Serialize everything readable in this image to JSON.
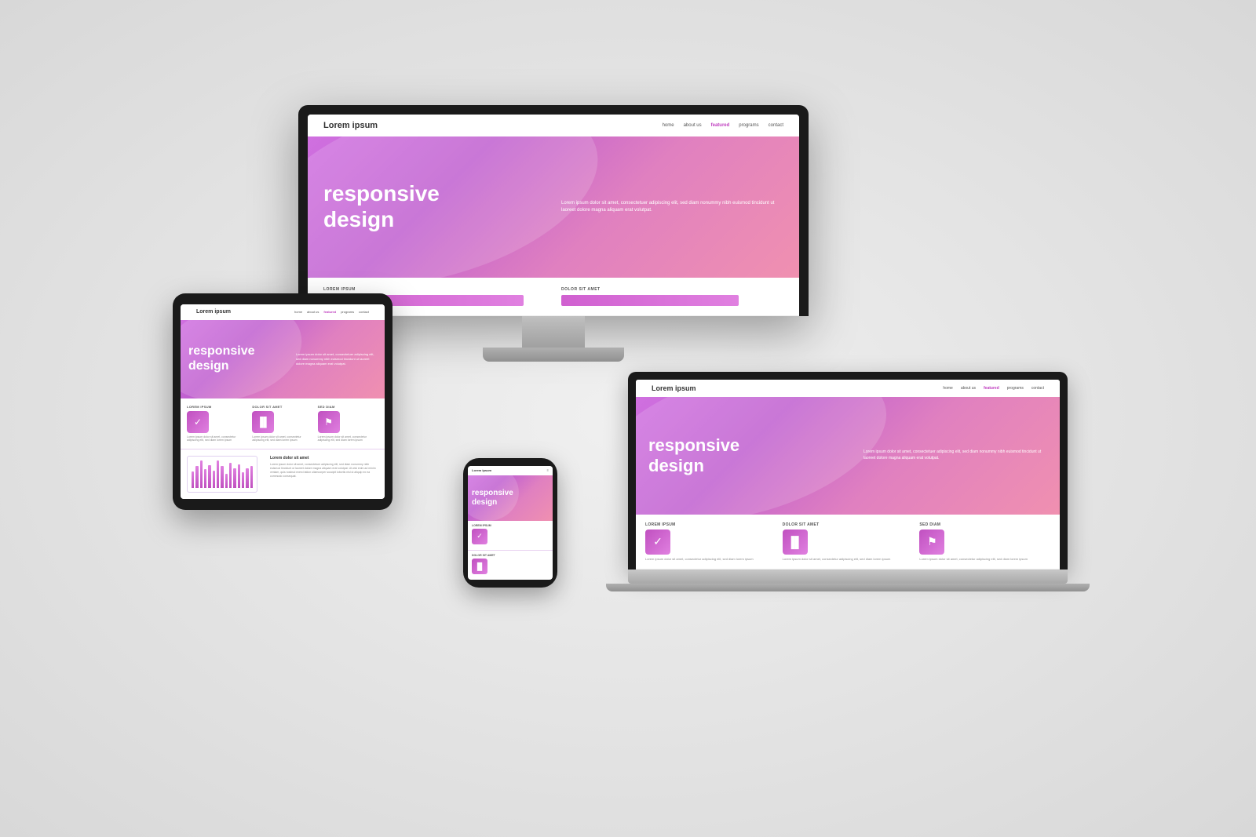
{
  "site": {
    "logo": "Lorem ipsum",
    "nav": {
      "links": [
        "home",
        "about us",
        "featured",
        "programs",
        "contact"
      ]
    },
    "hero": {
      "title_line1": "responsive",
      "title_line2": "design",
      "body_text": "Lorem ipsum dolor sit amet, consectetuer adipiscing elit, sed diam nonummy nibh euismod tincidunt ut laoreet dolore magna aliquam erat volutpat."
    },
    "sections": [
      {
        "label": "LOREM IPSUM"
      },
      {
        "label": "DOLOR SIT AMET"
      }
    ],
    "features": [
      {
        "label": "LOREM IPSUM",
        "icon": "✓"
      },
      {
        "label": "DOLOR SIT AMET",
        "icon": "📊"
      },
      {
        "label": "SED DIAM",
        "icon": "⚑"
      }
    ],
    "chart_section": {
      "title": "Lorem dolor sit amet",
      "body": "Lorem ipsum dolor sit amet, consectetuer adipiscing elit, sed diam nonummy nibh euismod tincidunt ut laoreet dolore magna aliquam erat volutpat. Ut wisi enim ad minim veniam, quis nostrud exerci tation ullamcorper suscipit lobortis nisl ut aliquip ex ea commodo consequat."
    }
  },
  "bars": [
    20,
    28,
    35,
    25,
    30,
    22,
    35,
    28,
    18,
    32,
    25,
    30,
    20,
    25,
    28
  ]
}
